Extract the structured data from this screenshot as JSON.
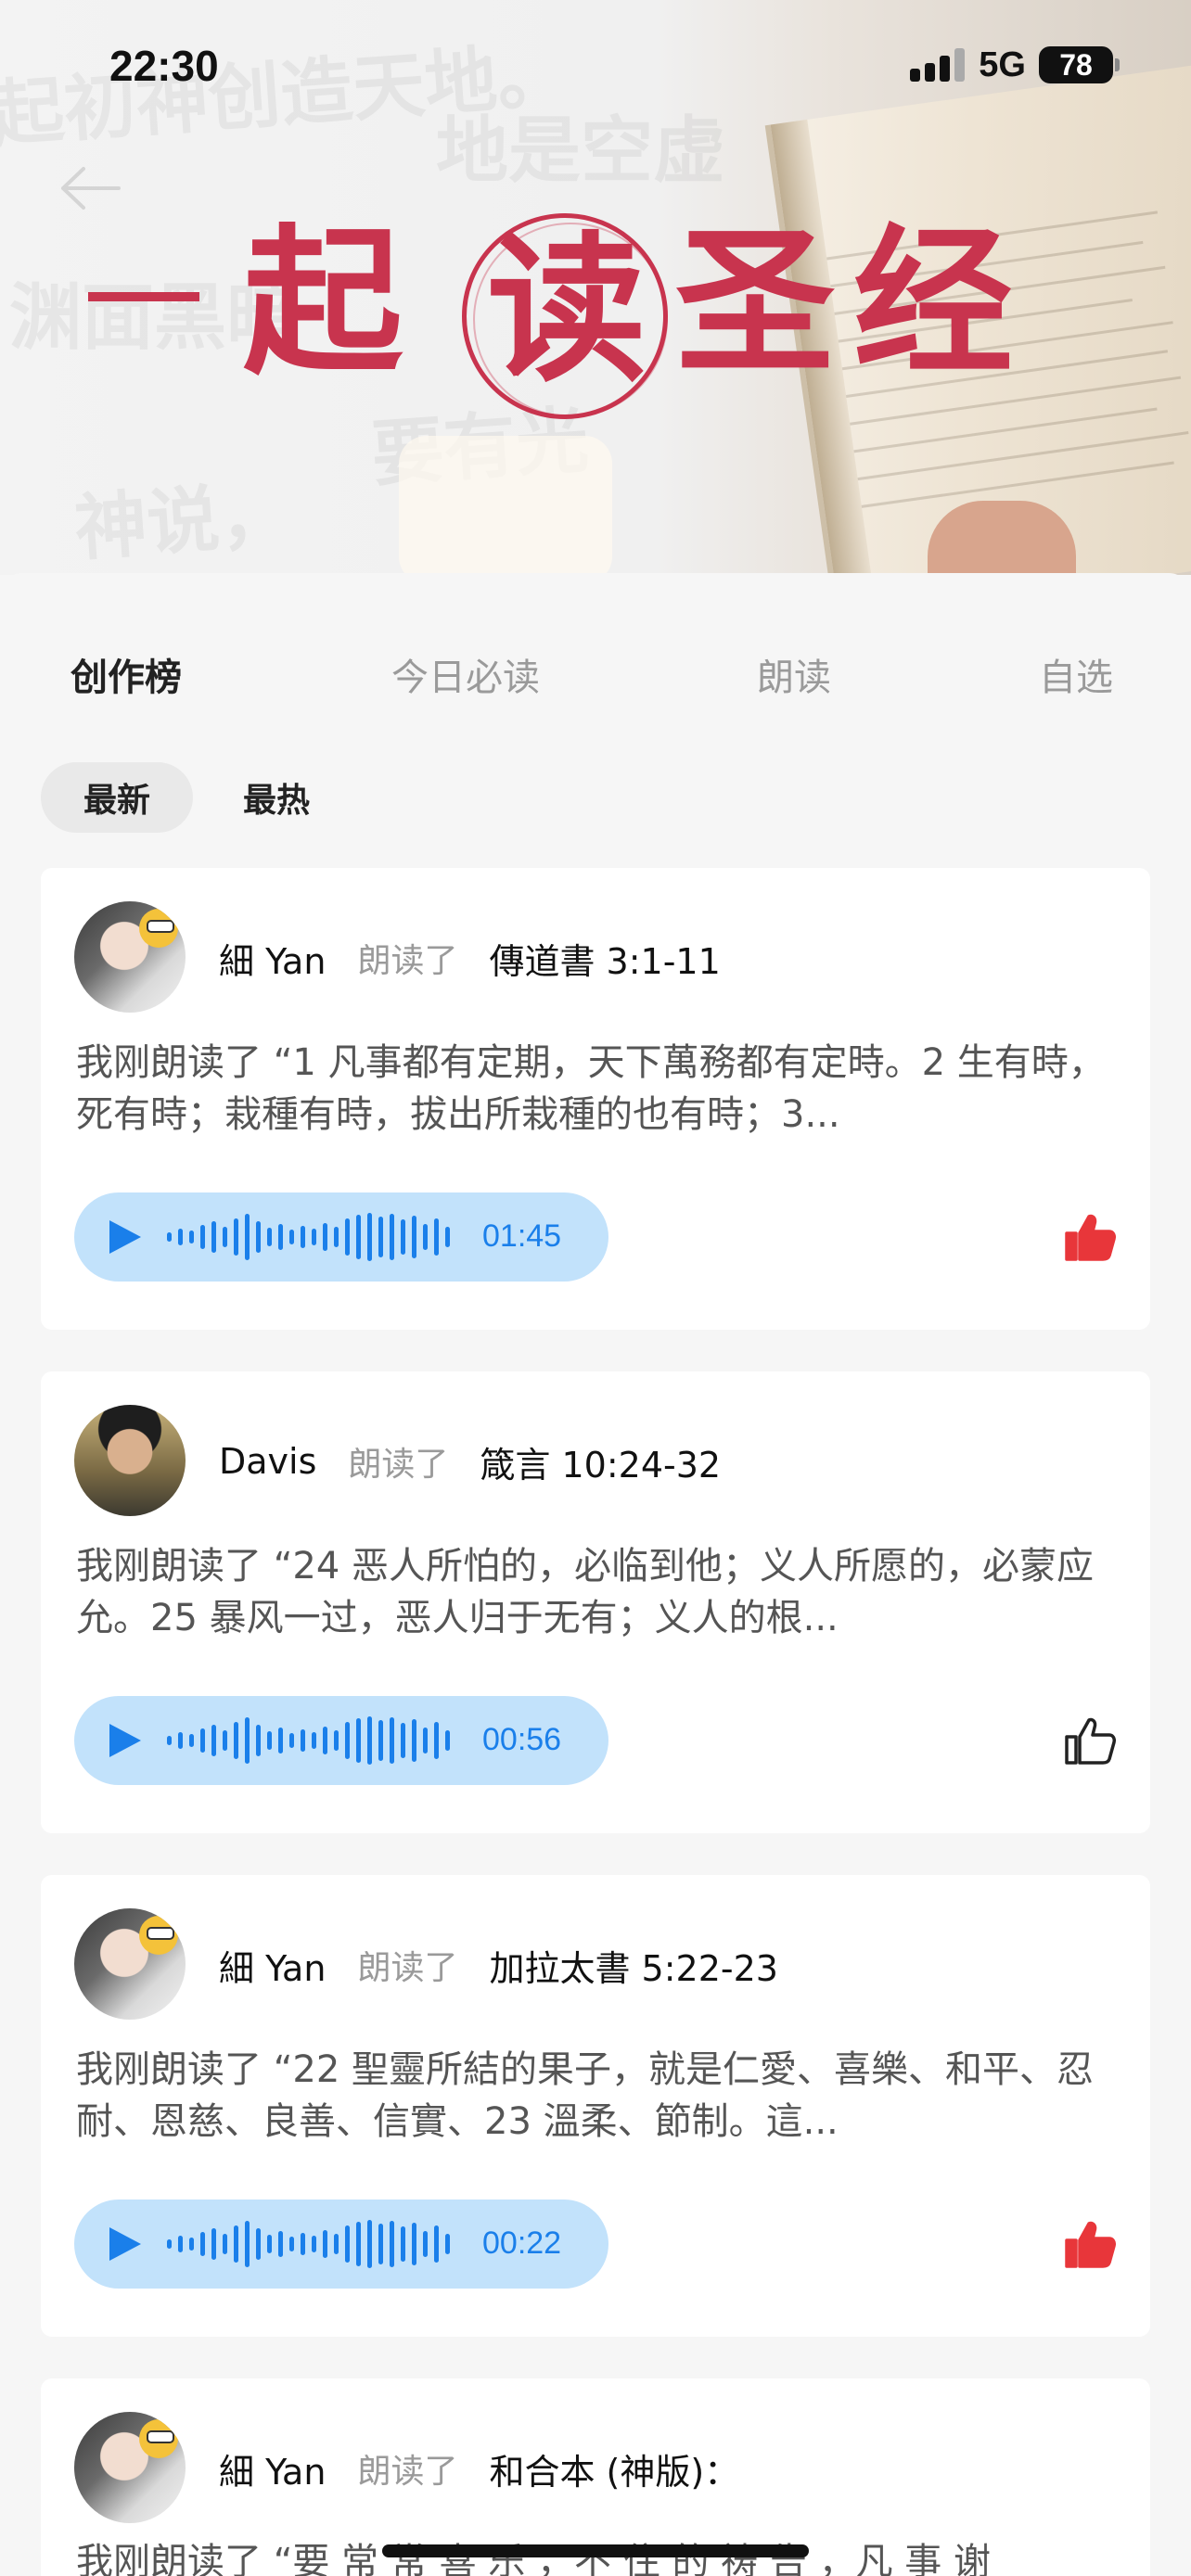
{
  "status_bar": {
    "time": "22:30",
    "network": "5G",
    "battery": "78"
  },
  "banner": {
    "title_chars": [
      "起",
      "读",
      "圣",
      "经"
    ],
    "background_text": [
      "起初神创造天地。",
      "地是空虚",
      "渊面黑暗",
      "神说，",
      "要有光"
    ],
    "back_icon": "back-arrow-icon"
  },
  "tabs": [
    {
      "label": "创作榜",
      "active": true
    },
    {
      "label": "今日必读",
      "active": false
    },
    {
      "label": "朗读",
      "active": false
    },
    {
      "label": "自选",
      "active": false
    }
  ],
  "filters": [
    {
      "label": "最新",
      "active": true
    },
    {
      "label": "最热",
      "active": false
    }
  ],
  "posts": [
    {
      "user": "細 Yan",
      "verb": "朗读了",
      "reference": "傳道書 3:1-11",
      "text": "我刚朗读了 “1  凡事都有定期，天下萬務都有定時。2  生有時，死有時；栽種有時，拔出所栽種的也有時；3...",
      "duration": "01:45",
      "liked": true,
      "avatar": "girl"
    },
    {
      "user": "Davis",
      "verb": "朗读了",
      "reference": "箴言 10:24-32",
      "text": "我刚朗读了 “24  恶人所怕的，必临到他；义人所愿的，必蒙应允。25  暴风一过，恶人归于无有；义人的根...",
      "duration": "00:56",
      "liked": false,
      "avatar": "boy"
    },
    {
      "user": "細 Yan",
      "verb": "朗读了",
      "reference": "加拉太書 5:22-23",
      "text": "我刚朗读了 “22  聖靈所結的果子，就是仁愛、喜樂、和平、忍耐、恩慈、良善、信實、23  溫柔、節制。這...",
      "duration": "00:22",
      "liked": true,
      "avatar": "girl"
    },
    {
      "user": "細 Yan",
      "verb": "朗读了",
      "reference": "和合本 (神版)：",
      "text": "我刚朗读了 “要 常 常 喜 乐 ，不 住 的 祷 告 ，凡 事 谢",
      "duration": "",
      "liked": false,
      "avatar": "girl"
    }
  ],
  "colors": {
    "accent_red": "#c8344e",
    "like_red": "#e8363a",
    "player_bg": "#c2e2fb",
    "player_blue": "#1a7fea"
  }
}
